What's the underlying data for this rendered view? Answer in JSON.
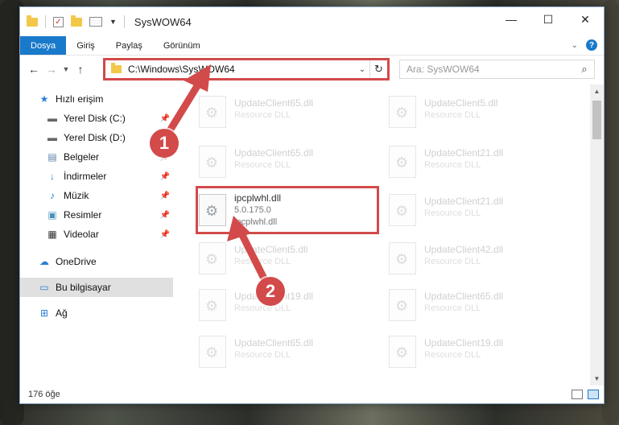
{
  "window": {
    "title": "SysWOW64",
    "controls": {
      "minimize": "—",
      "maximize": "☐",
      "close": "✕"
    }
  },
  "ribbon": {
    "tabs": [
      "Dosya",
      "Giriş",
      "Paylaş",
      "Görünüm"
    ],
    "help": "?"
  },
  "nav": {
    "address": "C:\\Windows\\SysWOW64",
    "search_placeholder": "Ara: SysWOW64"
  },
  "sidebar": {
    "items": [
      {
        "label": "Hızlı erişim",
        "icon": "star-icon",
        "pinned": false
      },
      {
        "label": "Yerel Disk (C:)",
        "icon": "drive-icon",
        "pinned": true
      },
      {
        "label": "Yerel Disk (D:)",
        "icon": "drive-icon",
        "pinned": false
      },
      {
        "label": "Belgeler",
        "icon": "documents-icon",
        "pinned": true
      },
      {
        "label": "İndirmeler",
        "icon": "download-icon",
        "pinned": true
      },
      {
        "label": "Müzik",
        "icon": "music-icon",
        "pinned": true
      },
      {
        "label": "Resimler",
        "icon": "pictures-icon",
        "pinned": true
      },
      {
        "label": "Videolar",
        "icon": "video-icon",
        "pinned": true
      },
      {
        "label": "OneDrive",
        "icon": "cloud-icon",
        "pinned": false
      },
      {
        "label": "Bu bilgisayar",
        "icon": "computer-icon",
        "pinned": false
      },
      {
        "label": "Ağ",
        "icon": "network-icon",
        "pinned": false
      }
    ]
  },
  "files": [
    {
      "name": "UpdateClient65.dll",
      "sub": "Resource DLL",
      "faded": true
    },
    {
      "name": "UpdateClient5.dll",
      "sub": "Resource DLL",
      "faded": true
    },
    {
      "name": "UpdateClient65.dll",
      "sub": "Resource DLL",
      "faded": true
    },
    {
      "name": "UpdateClient21.dll",
      "sub": "Resource DLL",
      "faded": true
    },
    {
      "name": "ipcplwhl.dll",
      "sub": "5.0.175.0",
      "sub2": "ipcplwhl.dll",
      "faded": false
    },
    {
      "name": "UpdateClient21.dll",
      "sub": "Resource DLL",
      "faded": true
    },
    {
      "name": "UpdateClient5.dll",
      "sub": "Resource DLL",
      "faded": true
    },
    {
      "name": "UpdateClient42.dll",
      "sub": "Resource DLL",
      "faded": true
    },
    {
      "name": "UpdateClient19.dll",
      "sub": "Resource DLL",
      "faded": true
    },
    {
      "name": "UpdateClient65.dll",
      "sub": "Resource DLL",
      "faded": true
    },
    {
      "name": "UpdateClient65.dll",
      "sub": "Resource DLL",
      "faded": true
    },
    {
      "name": "UpdateClient19.dll",
      "sub": "Resource DLL",
      "faded": true
    }
  ],
  "status": {
    "count": "176 öğe"
  },
  "annotations": {
    "step1": "1",
    "step2": "2",
    "color": "#d24a4a"
  }
}
